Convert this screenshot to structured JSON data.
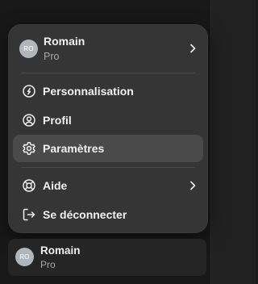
{
  "menu": {
    "header": {
      "avatar_initials": "RO",
      "name": "Romain",
      "plan": "Pro"
    },
    "items": [
      {
        "label": "Personnalisation",
        "icon": "personalization-icon",
        "active": false
      },
      {
        "label": "Profil",
        "icon": "profile-icon",
        "active": false
      },
      {
        "label": "Paramètres",
        "icon": "gear-icon",
        "active": true
      },
      {
        "label": "Aide",
        "icon": "help-lifebuoy-icon",
        "has_submenu": true,
        "active": false
      },
      {
        "label": "Se déconnecter",
        "icon": "logout-icon",
        "active": false
      }
    ]
  },
  "user_card": {
    "avatar_initials": "RO",
    "name": "Romain",
    "plan": "Pro"
  },
  "colors": {
    "page_background": "#1b1b1b",
    "menu_background": "#353535",
    "active_item_background": "#4a4a4a",
    "avatar": "#b2b6bb",
    "text_primary": "#f0f0f0",
    "text_secondary": "#a8a8a8"
  }
}
